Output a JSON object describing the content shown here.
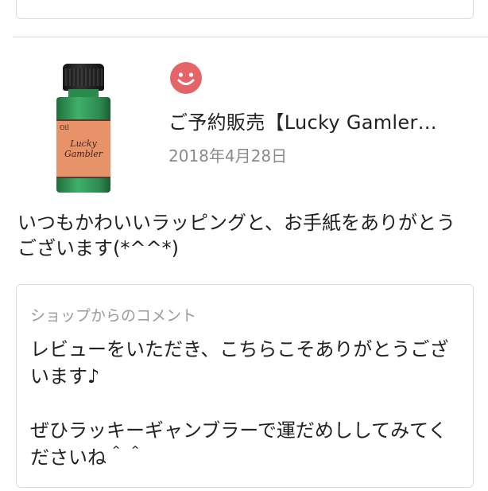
{
  "review_item": {
    "product_title": "ご予約販売【Lucky Gamler…",
    "date": "2018年4月28日",
    "rating_icon": "smile-face-icon",
    "rating_color": "#e56468",
    "product_label_text": [
      "Lucky",
      "Gambler"
    ],
    "review_text": "いつもかわいいラッピングと、お手紙をありがとうございます(*^^*)"
  },
  "shop_comment": {
    "heading": "ショップからのコメント",
    "text": "レビューをいただき、こちらこそありがとうございます♪\n\nぜひラッキーギャンブラーで運だめししてみてくださいね＾＾"
  }
}
